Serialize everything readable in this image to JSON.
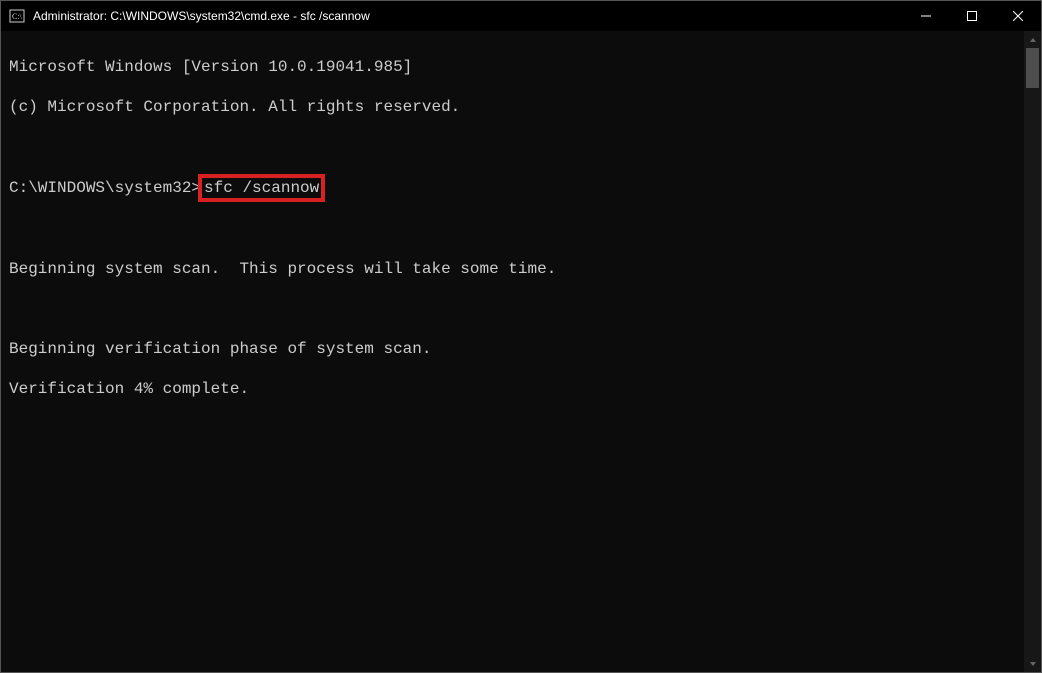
{
  "titlebar": {
    "title": "Administrator: C:\\WINDOWS\\system32\\cmd.exe - sfc  /scannow"
  },
  "terminal": {
    "line1": "Microsoft Windows [Version 10.0.19041.985]",
    "line2": "(c) Microsoft Corporation. All rights reserved.",
    "prompt": "C:\\WINDOWS\\system32>",
    "command": "sfc /scannow",
    "line3": "Beginning system scan.  This process will take some time.",
    "line4": "Beginning verification phase of system scan.",
    "line5": "Verification 4% complete."
  },
  "highlight_color": "#d92121"
}
